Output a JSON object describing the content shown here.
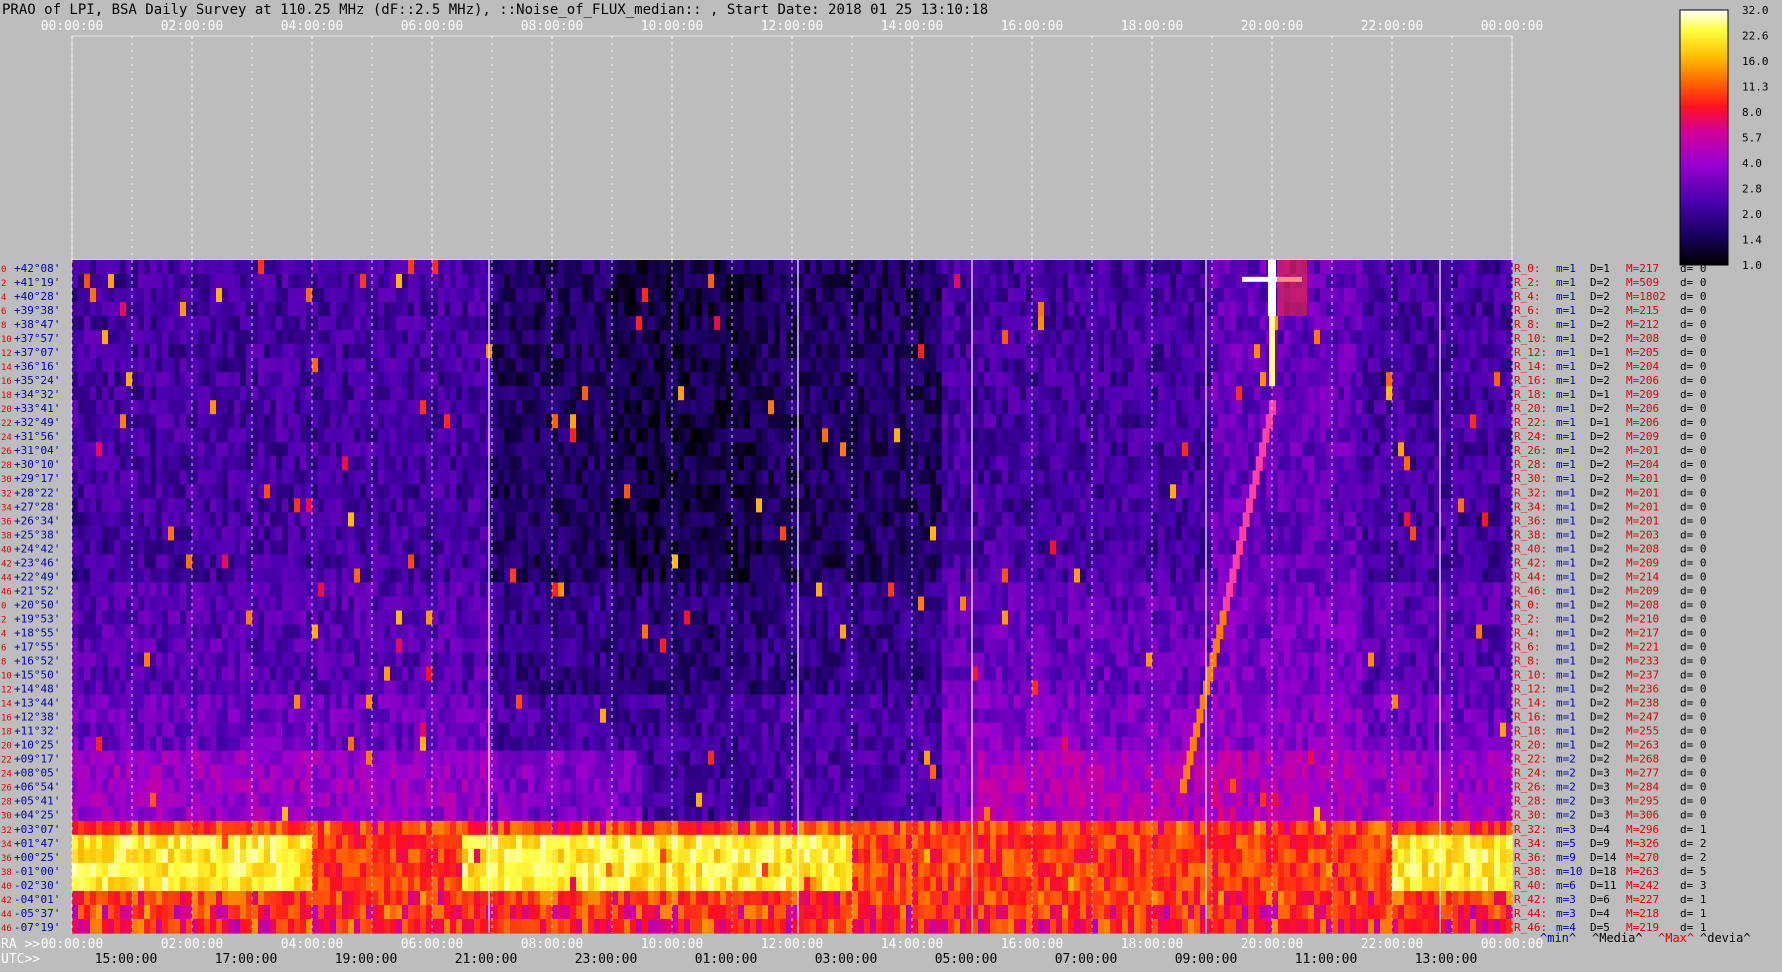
{
  "title": "PRAO of LPI, BSA Daily Survey at 110.25 MHz (dF::2.5 MHz), ::Noise_of_FLUX_median:: , Start Date: 2018 01 25 13:10:18",
  "colors": {
    "background": "#bdbdbd",
    "label_red": "#e00000",
    "label_blue": "#0000b0",
    "grid": "#ffffff"
  },
  "top_time_labels": [
    "00:00:00",
    "02:00:00",
    "04:00:00",
    "06:00:00",
    "08:00:00",
    "10:00:00",
    "12:00:00",
    "14:00:00",
    "16:00:00",
    "18:00:00",
    "20:00:00",
    "22:00:00",
    "00:00:00"
  ],
  "bottom_axis": {
    "ra_prefix": "RA >>",
    "utc_prefix": "UTC>>",
    "ra_labels": [
      "00:00:00",
      "02:00:00",
      "04:00:00",
      "06:00:00",
      "08:00:00",
      "10:00:00",
      "12:00:00",
      "14:00:00",
      "16:00:00",
      "18:00:00",
      "20:00:00",
      "22:00:00",
      "00:00:00"
    ],
    "utc_labels": [
      "15:00:00",
      "17:00:00",
      "19:00:00",
      "21:00:00",
      "23:00:00",
      "01:00:00",
      "03:00:00",
      "05:00:00",
      "07:00:00",
      "09:00:00",
      "11:00:00",
      "13:00:00"
    ]
  },
  "legend": {
    "min": "^min^",
    "media": "^Media^",
    "max": "^Max^",
    "devia": "^devia^"
  },
  "colorbar": {
    "ticks": [
      "32.0",
      "22.6",
      "16.0",
      "11.3",
      "8.0",
      "5.7",
      "4.0",
      "2.8",
      "2.0",
      "1.4",
      "1.0"
    ]
  },
  "row_numbers": [
    "0",
    "2",
    "4",
    "6",
    "8",
    "10",
    "12",
    "14",
    "16",
    "18",
    "20",
    "22",
    "24",
    "26",
    "28",
    "30",
    "32",
    "34",
    "36",
    "38",
    "40",
    "42",
    "44",
    "46",
    "0",
    "2",
    "4",
    "6",
    "8",
    "10",
    "12",
    "14",
    "16",
    "18",
    "20",
    "22",
    "24",
    "26",
    "28",
    "30",
    "32",
    "34",
    "36",
    "38",
    "40",
    "42",
    "44",
    "46"
  ],
  "declinations": [
    "+42°08'",
    "+41°19'",
    "+40°28'",
    "+39°38'",
    "+38°47'",
    "+37°57'",
    "+37°07'",
    "+36°16'",
    "+35°24'",
    "+34°32'",
    "+33°41'",
    "+32°49'",
    "+31°56'",
    "+31°04'",
    "+30°10'",
    "+29°17'",
    "+28°22'",
    "+27°28'",
    "+26°34'",
    "+25°38'",
    "+24°42'",
    "+23°46'",
    "+22°49'",
    "+21°52'",
    "+20°50'",
    "+19°53'",
    "+18°55'",
    "+17°55'",
    "+16°52'",
    "+15°50'",
    "+14°48'",
    "+13°44'",
    "+12°38'",
    "+11°32'",
    "+10°25'",
    "+09°17'",
    "+08°05'",
    "+06°54'",
    "+05°41'",
    "+04°25'",
    "+03°07'",
    "+01°47'",
    "+00°25'",
    "-01°00'",
    "-02°30'",
    "-04°01'",
    "-05°37'",
    "-07°19'"
  ],
  "row_stats": [
    {
      "r": "R_0:",
      "m": "m=1",
      "d": "D=1",
      "M": "M=217",
      "dv": "d= 0"
    },
    {
      "r": "R_2:",
      "m": "m=1",
      "d": "D=2",
      "M": "M=509",
      "dv": "d= 0"
    },
    {
      "r": "R_4:",
      "m": "m=1",
      "d": "D=2",
      "M": "M=1802",
      "dv": "d= 0"
    },
    {
      "r": "R_6:",
      "m": "m=1",
      "d": "D=2",
      "M": "M=215",
      "dv": "d= 0"
    },
    {
      "r": "R_8:",
      "m": "m=1",
      "d": "D=2",
      "M": "M=212",
      "dv": "d= 0"
    },
    {
      "r": "R_10:",
      "m": "m=1",
      "d": "D=2",
      "M": "M=208",
      "dv": "d= 0"
    },
    {
      "r": "R_12:",
      "m": "m=1",
      "d": "D=1",
      "M": "M=205",
      "dv": "d= 0"
    },
    {
      "r": "R_14:",
      "m": "m=1",
      "d": "D=2",
      "M": "M=204",
      "dv": "d= 0"
    },
    {
      "r": "R_16:",
      "m": "m=1",
      "d": "D=2",
      "M": "M=206",
      "dv": "d= 0"
    },
    {
      "r": "R_18:",
      "m": "m=1",
      "d": "D=1",
      "M": "M=209",
      "dv": "d= 0"
    },
    {
      "r": "R_20:",
      "m": "m=1",
      "d": "D=2",
      "M": "M=206",
      "dv": "d= 0"
    },
    {
      "r": "R_22:",
      "m": "m=1",
      "d": "D=1",
      "M": "M=206",
      "dv": "d= 0"
    },
    {
      "r": "R_24:",
      "m": "m=1",
      "d": "D=2",
      "M": "M=209",
      "dv": "d= 0"
    },
    {
      "r": "R_26:",
      "m": "m=1",
      "d": "D=2",
      "M": "M=201",
      "dv": "d= 0"
    },
    {
      "r": "R_28:",
      "m": "m=1",
      "d": "D=2",
      "M": "M=204",
      "dv": "d= 0"
    },
    {
      "r": "R_30:",
      "m": "m=1",
      "d": "D=2",
      "M": "M=201",
      "dv": "d= 0"
    },
    {
      "r": "R_32:",
      "m": "m=1",
      "d": "D=2",
      "M": "M=201",
      "dv": "d= 0"
    },
    {
      "r": "R_34:",
      "m": "m=1",
      "d": "D=2",
      "M": "M=201",
      "dv": "d= 0"
    },
    {
      "r": "R_36:",
      "m": "m=1",
      "d": "D=2",
      "M": "M=201",
      "dv": "d= 0"
    },
    {
      "r": "R_38:",
      "m": "m=1",
      "d": "D=2",
      "M": "M=203",
      "dv": "d= 0"
    },
    {
      "r": "R_40:",
      "m": "m=1",
      "d": "D=2",
      "M": "M=208",
      "dv": "d= 0"
    },
    {
      "r": "R_42:",
      "m": "m=1",
      "d": "D=2",
      "M": "M=209",
      "dv": "d= 0"
    },
    {
      "r": "R_44:",
      "m": "m=1",
      "d": "D=2",
      "M": "M=214",
      "dv": "d= 0"
    },
    {
      "r": "R_46:",
      "m": "m=1",
      "d": "D=2",
      "M": "M=209",
      "dv": "d= 0"
    },
    {
      "r": "R_0:",
      "m": "m=1",
      "d": "D=2",
      "M": "M=208",
      "dv": "d= 0"
    },
    {
      "r": "R_2:",
      "m": "m=1",
      "d": "D=2",
      "M": "M=210",
      "dv": "d= 0"
    },
    {
      "r": "R_4:",
      "m": "m=1",
      "d": "D=2",
      "M": "M=217",
      "dv": "d= 0"
    },
    {
      "r": "R_6:",
      "m": "m=1",
      "d": "D=2",
      "M": "M=221",
      "dv": "d= 0"
    },
    {
      "r": "R_8:",
      "m": "m=1",
      "d": "D=2",
      "M": "M=233",
      "dv": "d= 0"
    },
    {
      "r": "R_10:",
      "m": "m=1",
      "d": "D=2",
      "M": "M=237",
      "dv": "d= 0"
    },
    {
      "r": "R_12:",
      "m": "m=1",
      "d": "D=2",
      "M": "M=236",
      "dv": "d= 0"
    },
    {
      "r": "R_14:",
      "m": "m=1",
      "d": "D=2",
      "M": "M=238",
      "dv": "d= 0"
    },
    {
      "r": "R_16:",
      "m": "m=1",
      "d": "D=2",
      "M": "M=247",
      "dv": "d= 0"
    },
    {
      "r": "R_18:",
      "m": "m=1",
      "d": "D=2",
      "M": "M=255",
      "dv": "d= 0"
    },
    {
      "r": "R_20:",
      "m": "m=1",
      "d": "D=2",
      "M": "M=263",
      "dv": "d= 0"
    },
    {
      "r": "R_22:",
      "m": "m=2",
      "d": "D=2",
      "M": "M=268",
      "dv": "d= 0"
    },
    {
      "r": "R_24:",
      "m": "m=2",
      "d": "D=3",
      "M": "M=277",
      "dv": "d= 0"
    },
    {
      "r": "R_26:",
      "m": "m=2",
      "d": "D=3",
      "M": "M=284",
      "dv": "d= 0"
    },
    {
      "r": "R_28:",
      "m": "m=2",
      "d": "D=3",
      "M": "M=295",
      "dv": "d= 0"
    },
    {
      "r": "R_30:",
      "m": "m=2",
      "d": "D=3",
      "M": "M=306",
      "dv": "d= 0"
    },
    {
      "r": "R_32:",
      "m": "m=3",
      "d": "D=4",
      "M": "M=296",
      "dv": "d= 1"
    },
    {
      "r": "R_34:",
      "m": "m=5",
      "d": "D=9",
      "M": "M=326",
      "dv": "d= 2"
    },
    {
      "r": "R_36:",
      "m": "m=9",
      "d": "D=14",
      "M": "M=270",
      "dv": "d= 2"
    },
    {
      "r": "R_38:",
      "m": "m=10",
      "d": "D=18",
      "M": "M=263",
      "dv": "d= 5"
    },
    {
      "r": "R_40:",
      "m": "m=6",
      "d": "D=11",
      "M": "M=242",
      "dv": "d= 3"
    },
    {
      "r": "R_42:",
      "m": "m=3",
      "d": "D=6",
      "M": "M=227",
      "dv": "d= 1"
    },
    {
      "r": "R_44:",
      "m": "m=3",
      "d": "D=4",
      "M": "M=218",
      "dv": "d= 1"
    },
    {
      "r": "R_46:",
      "m": "m=4",
      "d": "D=5",
      "M": "M=219",
      "dv": "d= 1"
    }
  ],
  "chart_data": {
    "type": "heatmap",
    "title": "PRAO of LPI, BSA Daily Survey at 110.25 MHz (dF::2.5 MHz), ::Noise_of_FLUX_median:: , Start Date: 2018 01 25 13:10:18",
    "x_axis": "RA 00:00:00 to 24:00:00 (top and bottom), UTC 13:10:18 start",
    "y_axis": "declination rows +42°08' to -07°19' (48 rays, R_0 to R_46, two blocks)",
    "color_scale": {
      "min": 1.0,
      "max": 32.0,
      "scale": "log2",
      "ticks": [
        32.0,
        22.6,
        16.0,
        11.3,
        8.0,
        5.7,
        4.0,
        2.8,
        2.0,
        1.4,
        1.0
      ]
    },
    "features": {
      "galactic_plane_band_declination": "+01°47' to -07°19'",
      "bright_source_ra": "20:00:00",
      "bright_source_declination": "+41°19' to +40°28'"
    }
  }
}
